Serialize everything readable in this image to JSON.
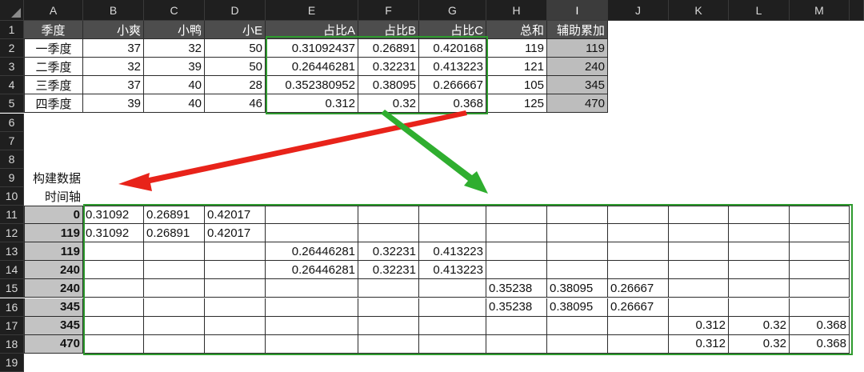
{
  "columns": [
    "A",
    "B",
    "C",
    "D",
    "E",
    "F",
    "G",
    "H",
    "I",
    "J",
    "K",
    "L",
    "M"
  ],
  "selected_column": "I",
  "rows": [
    "1",
    "2",
    "3",
    "4",
    "5",
    "6",
    "7",
    "8",
    "9",
    "10",
    "11",
    "12",
    "13",
    "14",
    "15",
    "16",
    "17",
    "18",
    "19"
  ],
  "table": {
    "headers": [
      "季度",
      "小爽",
      "小鸭",
      "小E",
      "占比A",
      "占比B",
      "占比C",
      "总和",
      "辅助累加"
    ],
    "rows": [
      [
        "一季度",
        "37",
        "32",
        "50",
        "0.31092437",
        "0.26891",
        "0.420168",
        "119",
        "119"
      ],
      [
        "二季度",
        "32",
        "39",
        "50",
        "0.26446281",
        "0.32231",
        "0.413223",
        "121",
        "240"
      ],
      [
        "三季度",
        "37",
        "40",
        "28",
        "0.352380952",
        "0.38095",
        "0.266667",
        "105",
        "345"
      ],
      [
        "四季度",
        "39",
        "40",
        "46",
        "0.312",
        "0.32",
        "0.368",
        "125",
        "470"
      ]
    ]
  },
  "notes": {
    "build_label": "构建数据",
    "axis_label": "时间轴"
  },
  "timeline": {
    "axis": [
      "0",
      "119",
      "119",
      "240",
      "240",
      "345",
      "345",
      "470"
    ],
    "rows": [
      [
        "0.31092",
        "0.26891",
        "0.42017",
        "",
        "",
        "",
        "",
        "",
        "",
        "",
        "",
        ""
      ],
      [
        "0.31092",
        "0.26891",
        "0.42017",
        "",
        "",
        "",
        "",
        "",
        "",
        "",
        "",
        ""
      ],
      [
        "",
        "",
        "",
        "0.26446281",
        "0.32231",
        "0.413223",
        "",
        "",
        "",
        "",
        "",
        ""
      ],
      [
        "",
        "",
        "",
        "0.26446281",
        "0.32231",
        "0.413223",
        "",
        "",
        "",
        "",
        "",
        ""
      ],
      [
        "",
        "",
        "",
        "",
        "",
        "",
        "0.35238",
        "0.38095",
        "0.26667",
        "",
        "",
        ""
      ],
      [
        "",
        "",
        "",
        "",
        "",
        "",
        "0.35238",
        "0.38095",
        "0.26667",
        "",
        "",
        ""
      ],
      [
        "",
        "",
        "",
        "",
        "",
        "",
        "",
        "",
        "",
        "0.312",
        "0.32",
        "0.368"
      ],
      [
        "",
        "",
        "",
        "",
        "",
        "",
        "",
        "",
        "",
        "0.312",
        "0.32",
        "0.368"
      ]
    ]
  },
  "colors": {
    "highlight_box": "#2e9a2e",
    "red_arrow": "#e8231a",
    "green_arrow": "#2fae2f",
    "header_fill": "#4d4d4d",
    "aux_fill": "#bdbdbd"
  }
}
